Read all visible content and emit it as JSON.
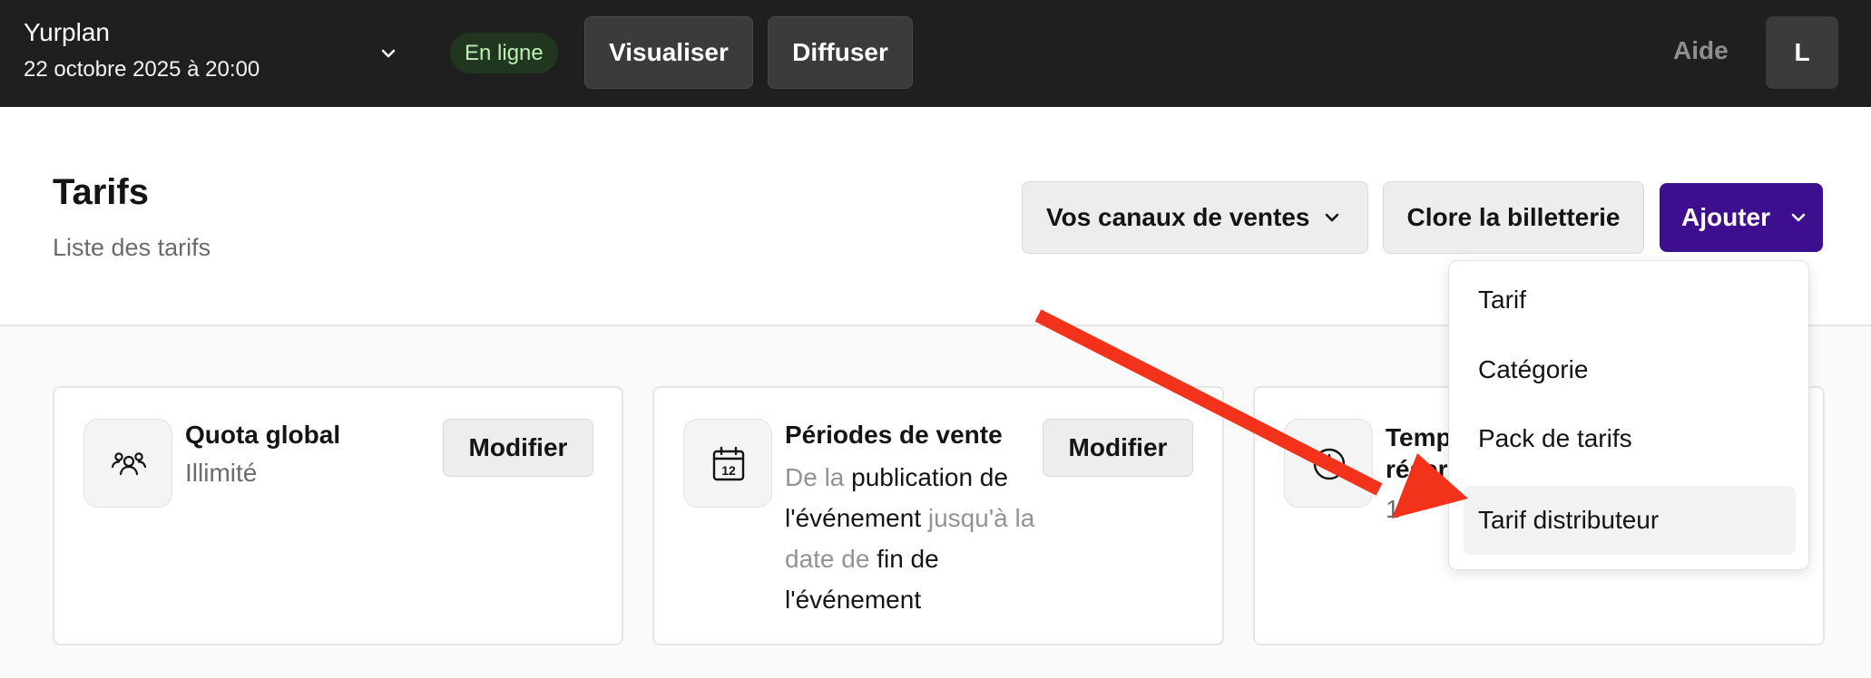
{
  "topbar": {
    "event_name": "Yurplan",
    "event_date": "22 octobre 2025 à 20:00",
    "status_badge": "En ligne",
    "visualiser_label": "Visualiser",
    "diffuser_label": "Diffuser",
    "help_label": "Aide",
    "avatar_initial": "L",
    "status_color": "#bfeeb4"
  },
  "header": {
    "title": "Tarifs",
    "subtitle": "Liste des tarifs",
    "channels_label": "Vos canaux de ventes",
    "close_label": "Clore la billetterie",
    "add_label": "Ajouter",
    "accent_color": "#3d0f8e"
  },
  "dropdown": {
    "items": [
      {
        "label": "Tarif"
      },
      {
        "label": "Catégorie"
      },
      {
        "label": "Pack de tarifs"
      },
      {
        "label": "Tarif distributeur"
      }
    ],
    "highlighted_item": "Tarif distributeur"
  },
  "cards": [
    {
      "title": "Quota global",
      "value": "Illimité",
      "button": "Modifier",
      "icon": "users-icon"
    },
    {
      "title": "Périodes de vente",
      "segments": [
        "De la",
        "publication de l'événement",
        "jusqu'à la date de",
        "fin de l'événement"
      ],
      "button": "Modifier",
      "icon": "calendar-icon",
      "icon_number": "12"
    },
    {
      "title_partial": "Temp",
      "line2_partial": "réser",
      "value_partial": "1",
      "icon": "clock-icon"
    }
  ],
  "annotation": {
    "arrow_color": "#f2321b"
  }
}
